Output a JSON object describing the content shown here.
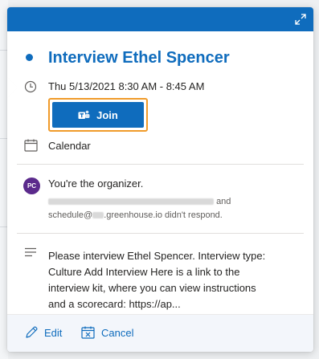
{
  "event": {
    "title": "Interview Ethel Spencer",
    "datetime": "Thu 5/13/2021 8:30 AM - 8:45 AM",
    "join_label": "Join",
    "calendar_label": "Calendar",
    "organizer_initials": "PC",
    "organizer_text": "You're the organizer.",
    "attendee_line_suffix": "and",
    "attendee_line2_prefix": "schedule@",
    "attendee_line2_suffix": ".greenhouse.io didn't respond.",
    "description_lines": [
      "Please interview Ethel Spencer. Interview type:",
      "Culture Add Interview Here is a link to the",
      "interview kit, where you can view instructions",
      "and a scorecard: https://ap..."
    ]
  },
  "footer": {
    "edit_label": "Edit",
    "cancel_label": "Cancel"
  },
  "icons": {
    "expand": "expand-icon",
    "clock": "clock-icon",
    "calendar": "calendar-icon",
    "teams": "teams-icon",
    "notes": "notes-icon",
    "edit": "edit-pencil-icon",
    "cancel": "cancel-calendar-icon"
  },
  "colors": {
    "accent": "#0f6cbd",
    "join_highlight": "#f09b2a",
    "avatar": "#5b2a8c"
  }
}
